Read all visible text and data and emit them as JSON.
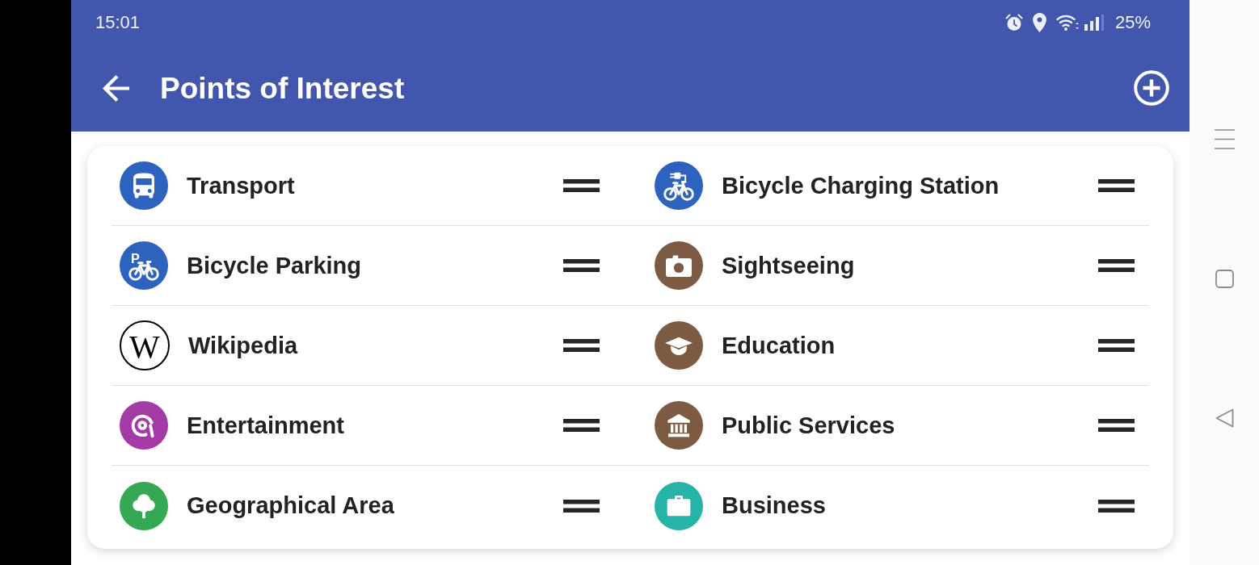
{
  "status_bar": {
    "time": "15:01",
    "battery": "25%"
  },
  "toolbar": {
    "title": "Points of Interest"
  },
  "items": [
    {
      "label": "Transport",
      "color": "#2d62bf"
    },
    {
      "label": "Bicycle Charging Station",
      "color": "#2d62bf"
    },
    {
      "label": "Bicycle Parking",
      "color": "#2d62bf",
      "icon_letter": "P"
    },
    {
      "label": "Sightseeing",
      "color": "#7c5b42"
    },
    {
      "label": "Wikipedia",
      "color": "#ffffff",
      "icon_letter": "W"
    },
    {
      "label": "Education",
      "color": "#7c5b42"
    },
    {
      "label": "Entertainment",
      "color": "#a43aa6"
    },
    {
      "label": "Public Services",
      "color": "#7c5b42"
    },
    {
      "label": "Geographical Area",
      "color": "#34a853"
    },
    {
      "label": "Business",
      "color": "#26b3a8"
    }
  ]
}
